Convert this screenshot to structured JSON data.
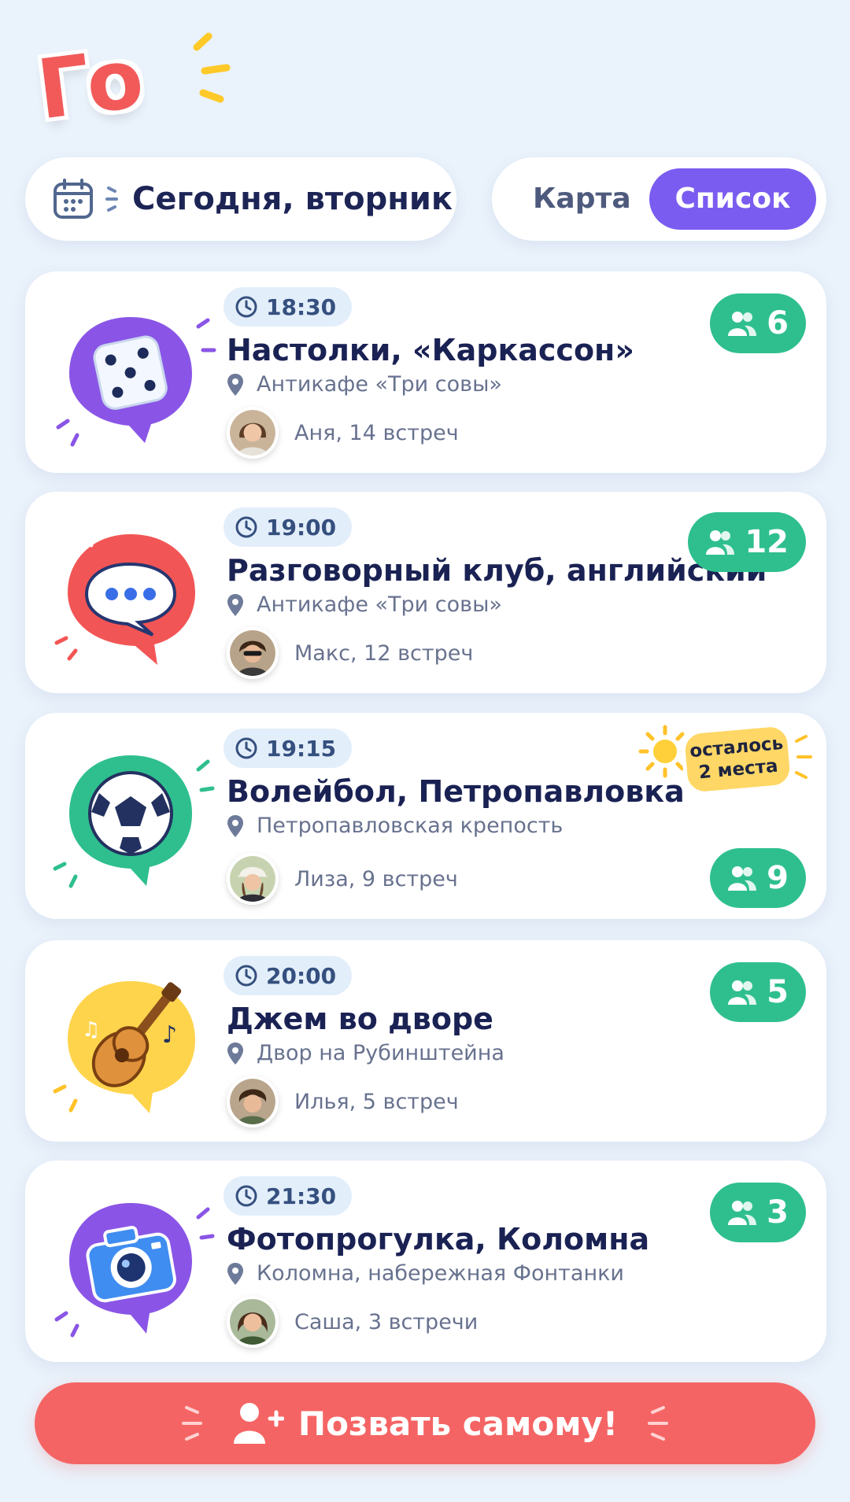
{
  "app": {
    "logo_text": "Го"
  },
  "header": {
    "date_label": "Сегодня, вторник",
    "view_toggle": {
      "map_label": "Карта",
      "list_label": "Список",
      "selected": "Список"
    }
  },
  "colors": {
    "accent_purple": "#7b5cf0",
    "count_green": "#2fbf8f",
    "cta_red": "#f56464",
    "sticker_yellow": "#ffd766"
  },
  "events": [
    {
      "time": "18:30",
      "title": "Настолки, «Каркассон»",
      "place": "Антикафе «Три совы»",
      "host": "Аня, 14 встреч",
      "count": "6",
      "icon": "dice-icon"
    },
    {
      "time": "19:00",
      "title": "Разговорный клуб, английский",
      "place": "Антикафе «Три совы»",
      "host": "Макс, 12 встреч",
      "count": "12",
      "icon": "chat-bubble-icon"
    },
    {
      "time": "19:15",
      "title": "Волейбол, Петропавловка",
      "place": "Петропавловская крепость",
      "host": "Лиза, 9 встреч",
      "count": "9",
      "icon": "ball-icon",
      "badge": "осталось 2 места"
    },
    {
      "time": "20:00",
      "title": "Джем во дворе",
      "place": "Двор на Рубинштейна",
      "host": "Илья, 5 встреч",
      "count": "5",
      "icon": "guitar-icon"
    },
    {
      "time": "21:30",
      "title": "Фотопрогулка, Коломна",
      "place": "Коломна, набережная Фонтанки",
      "host": "Саша, 3 встречи",
      "count": "3",
      "icon": "camera-icon"
    }
  ],
  "cta": {
    "label": "Позвать самому!"
  }
}
